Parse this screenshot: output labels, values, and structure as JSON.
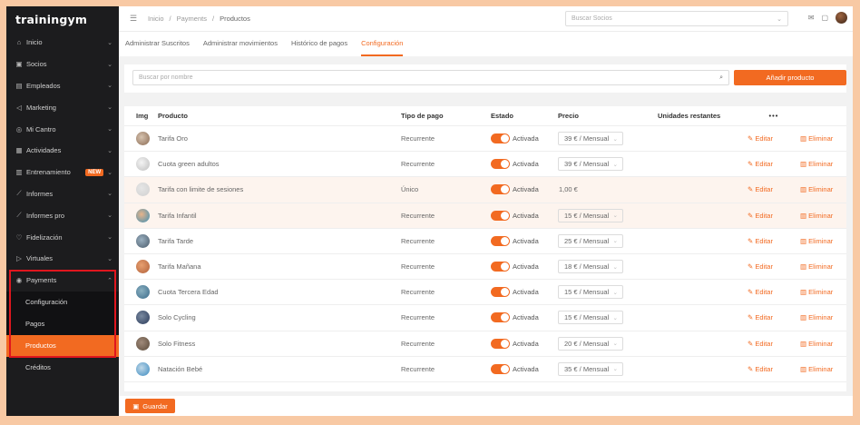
{
  "app": {
    "logo": "trainingym",
    "accent": "#f26a21"
  },
  "sidebar": {
    "items": [
      {
        "icon": "home-icon",
        "glyph": "⌂",
        "label": "Inicio"
      },
      {
        "icon": "members-icon",
        "glyph": "▣",
        "label": "Socios"
      },
      {
        "icon": "employees-icon",
        "glyph": "▤",
        "label": "Empleados"
      },
      {
        "icon": "megaphone-icon",
        "glyph": "◁",
        "label": "Marketing"
      },
      {
        "icon": "location-icon",
        "glyph": "◎",
        "label": "Mi Cantro"
      },
      {
        "icon": "calendar-icon",
        "glyph": "▦",
        "label": "Actividades"
      },
      {
        "icon": "training-icon",
        "glyph": "▥",
        "label": "Entrenamiento",
        "badge": "NEW"
      },
      {
        "icon": "chart-icon",
        "glyph": "⟋",
        "label": "Informes"
      },
      {
        "icon": "chart-pro-icon",
        "glyph": "⟋",
        "label": "Informes pro"
      },
      {
        "icon": "heart-icon",
        "glyph": "♡",
        "label": "Fidelización"
      },
      {
        "icon": "video-icon",
        "glyph": "▷",
        "label": "Virtuales"
      }
    ],
    "payments": {
      "label": "Payments",
      "sub": [
        "Configuración",
        "Pagos",
        "Productos"
      ],
      "active": "Productos"
    },
    "creditos": "Créditos"
  },
  "topbar": {
    "breadcrumb": [
      "Inicio",
      "/",
      "Payments",
      "/",
      "Productos"
    ],
    "search_placeholder": "Buscar Socios"
  },
  "tabs": [
    "Administrar Suscritos",
    "Administrar movimientos",
    "Histórico de pagos",
    "Configuración"
  ],
  "active_tab": "Configuración",
  "search": {
    "placeholder": "Buscar por nombre"
  },
  "add_button": "Añadir producto",
  "table": {
    "headers": {
      "img": "Img",
      "producto": "Producto",
      "tipo": "Tipo de pago",
      "estado": "Estado",
      "precio": "Precio",
      "unidades": "Unidades restantes",
      "more": "•••"
    },
    "rows": [
      {
        "producto": "Tarifa Oro",
        "tipo": "Recurrente",
        "estado": "Activada",
        "precio": "39 € / Mensual",
        "select": true,
        "thumb": [
          "#8a6a52",
          "#d6c3b0"
        ]
      },
      {
        "producto": "Cuota green adultos",
        "tipo": "Recurrente",
        "estado": "Activada",
        "precio": "39 € / Mensual",
        "select": true,
        "thumb": [
          "#bdbdbd",
          "#f4f4f4"
        ]
      },
      {
        "producto": "Tarifa con limite de sesiones",
        "tipo": "Único",
        "estado": "Activada",
        "precio": "1,00 €",
        "select": false,
        "thumb": [
          "#d0d0d0",
          "#e6e6e6"
        ],
        "highlight": true
      },
      {
        "producto": "Tarifa Infantil",
        "tipo": "Recurrente",
        "estado": "Activada",
        "precio": "15 € / Mensual",
        "select": true,
        "thumb": [
          "#3c8fb5",
          "#e8b48a"
        ],
        "highlight": true
      },
      {
        "producto": "Tarifa Tarde",
        "tipo": "Recurrente",
        "estado": "Activada",
        "precio": "25 € / Mensual",
        "select": true,
        "thumb": [
          "#4a5a6a",
          "#9ab0c0"
        ]
      },
      {
        "producto": "Tarifa Mañana",
        "tipo": "Recurrente",
        "estado": "Activada",
        "precio": "18 € / Mensual",
        "select": true,
        "thumb": [
          "#b0603a",
          "#e8a070"
        ]
      },
      {
        "producto": "Cuota Tercera Edad",
        "tipo": "Recurrente",
        "estado": "Activada",
        "precio": "15 € / Mensual",
        "select": true,
        "thumb": [
          "#3a6a8a",
          "#8ab0c0"
        ]
      },
      {
        "producto": "Solo Cycling",
        "tipo": "Recurrente",
        "estado": "Activada",
        "precio": "15 € / Mensual",
        "select": true,
        "thumb": [
          "#2a3a5a",
          "#7a8aa0"
        ]
      },
      {
        "producto": "Solo Fitness",
        "tipo": "Recurrente",
        "estado": "Activada",
        "precio": "20 € / Mensual",
        "select": true,
        "thumb": [
          "#5a4a3a",
          "#a08a7a"
        ]
      },
      {
        "producto": "Natación Bebé",
        "tipo": "Recurrente",
        "estado": "Activada",
        "precio": "35 € / Mensual",
        "select": true,
        "thumb": [
          "#3a8ac0",
          "#c0d8e8"
        ]
      }
    ],
    "edit_label": "Editar",
    "delete_label": "Eliminar"
  },
  "save_button": "Guardar"
}
